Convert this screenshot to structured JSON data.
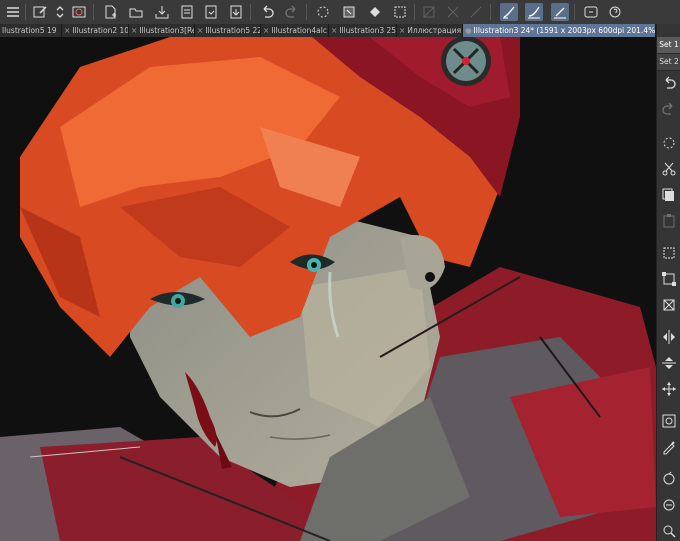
{
  "toolbar": {
    "icons": [
      "menu-icon",
      "pen-edit-icon",
      "up-down-icon",
      "snapshot-icon",
      "new-file-icon",
      "open-folder-icon",
      "save-icon",
      "export-icon",
      "export-image-icon",
      "export-layer-icon",
      "undo-icon",
      "redo-icon",
      "clear-icon",
      "fill-icon",
      "transform-icon",
      "crop-icon",
      "disabled-1-icon",
      "disabled-2-icon",
      "stabilizer-icon",
      "pen-pressure-icon",
      "pen-angle-icon",
      "help-icon",
      "search-icon"
    ]
  },
  "tabs": [
    {
      "label": "llustration5 19",
      "close": "×"
    },
    {
      "label": "Illustration2 10",
      "close": "×"
    },
    {
      "label": "Illustration3[Re",
      "close": "×"
    },
    {
      "label": "Illustration5 22",
      "close": "×"
    },
    {
      "label": "Illustration4alc",
      "close": "×"
    },
    {
      "label": "Illustration3 25",
      "close": "×"
    },
    {
      "label": "Иллюстрация",
      "close": "×"
    },
    {
      "label": "Illustration3 24* (1591 x 2003px 600dpi 201.4%)",
      "close": "●"
    }
  ],
  "tabbar_menu": "⌄",
  "sidebar": {
    "set1": "Set 1",
    "set2": "Set 2"
  },
  "colors": {
    "accent": "#5f7595",
    "toolbar_bg": "#3a3a3a",
    "hair": "#e0552a",
    "hood": "#9a1f2a",
    "skin": "#a8a89a"
  }
}
